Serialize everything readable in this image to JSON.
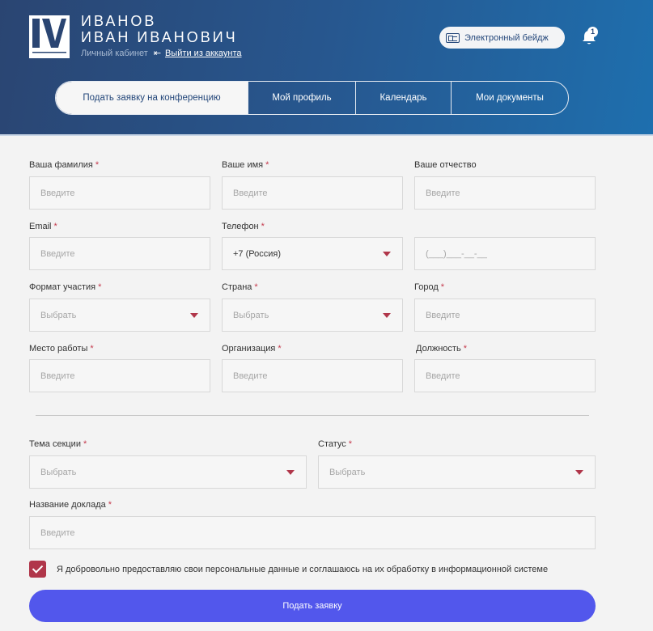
{
  "header": {
    "last_name": "ИВАНОВ",
    "first_middle": "ИВАН ИВАНОВИЧ",
    "cabinet_label": "Личный кабинет",
    "logout_label": "Выйти из аккаунта",
    "badge_label": "Электронный бейдж",
    "notification_count": "1"
  },
  "tabs": [
    {
      "label": "Подать заявку на конференцию",
      "active": true
    },
    {
      "label": "Мой профиль"
    },
    {
      "label": "Календарь"
    },
    {
      "label": "Мои документы"
    }
  ],
  "form": {
    "placeholder_enter": "Введите",
    "placeholder_choose": "Выбрать",
    "fields": {
      "last_name": {
        "label": "Ваша фамилия",
        "required": "*"
      },
      "first_name": {
        "label": "Ваше имя",
        "required": "*"
      },
      "middle_name": {
        "label": "Ваше отчество"
      },
      "email": {
        "label": "Email",
        "required": "*"
      },
      "phone": {
        "label": "Телефон",
        "required": "*",
        "country_value": "+7 (Россия)",
        "mask": "(___)___-__-__"
      },
      "format": {
        "label": "Формат участия",
        "required": "*"
      },
      "country": {
        "label": "Страна",
        "required": "*"
      },
      "city": {
        "label": "Город",
        "required": "*"
      },
      "workplace": {
        "label": "Место работы",
        "required": "*"
      },
      "organization": {
        "label": "Организация",
        "required": "*"
      },
      "position": {
        "label": "Должность",
        "required": "*"
      },
      "section": {
        "label": "Тема секции",
        "required": "*"
      },
      "status": {
        "label": "Статус",
        "required": "*"
      },
      "report_title": {
        "label": "Название доклада",
        "required": "*"
      }
    },
    "consent_text": "Я добровольно предоставляю свои персональные данные и соглашаюсь на их обработку в информационной системе",
    "consent_checked": true,
    "submit_label": "Подать заявку"
  },
  "colors": {
    "accent": "#5257ec",
    "required": "#c53a4d",
    "checkbox": "#b0364a",
    "header_dark": "#2a4572",
    "header_light": "#1e6fae"
  }
}
